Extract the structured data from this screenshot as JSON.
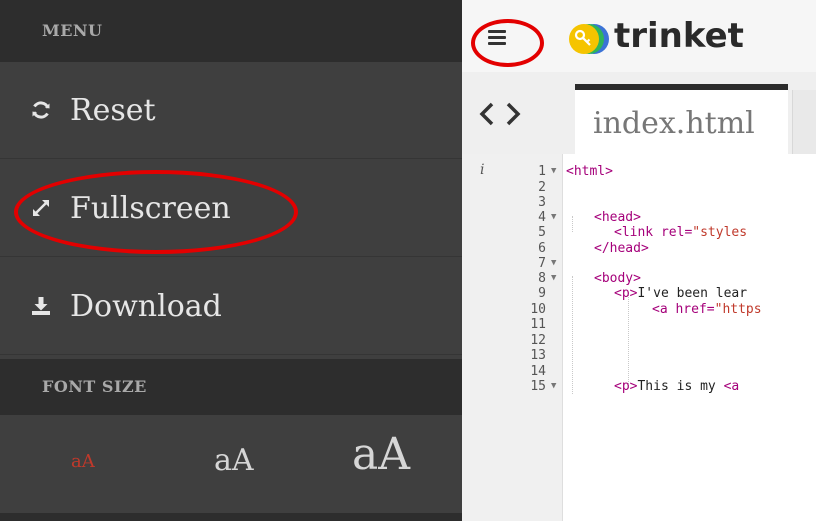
{
  "sidebar": {
    "menu_header": "MENU",
    "items": [
      {
        "label": "Reset",
        "icon": "refresh-icon"
      },
      {
        "label": "Fullscreen",
        "icon": "expand-icon"
      },
      {
        "label": "Download",
        "icon": "download-icon"
      }
    ],
    "font_size_header": "FONT SIZE",
    "font_options": [
      "aA",
      "aA",
      "aA"
    ]
  },
  "header": {
    "brand": "trinket",
    "menu_icon": "hamburger-menu-icon",
    "logo_icon": "trinket-logo-icon"
  },
  "tabs": {
    "nav_arrows": "‹ ›",
    "active_tab": "index.html"
  },
  "editor": {
    "info_marker": "i",
    "line_numbers": [
      "1",
      "2",
      "3",
      "4",
      "5",
      "6",
      "7",
      "8",
      "9",
      "10",
      "11",
      "12",
      "13",
      "14",
      "15"
    ],
    "code": {
      "l1": "<html>",
      "l3": "<head>",
      "l4a": "<link ",
      "l4b": "rel=",
      "l4c": "\"styles",
      "l5": "</head>",
      "l7": "<body>",
      "l8a": "<p>",
      "l8b": "I've been lear",
      "l9a": "<a ",
      "l9b": "href=",
      "l9c": "\"https",
      "l15a": "<p>",
      "l15b": "This is my ",
      "l15c": "<a"
    }
  },
  "colors": {
    "sidebar_bg": "#3f3f3f",
    "sidebar_header_bg": "#2d2d2d",
    "highlight_ring": "#e30000",
    "tag_color": "#a5007a",
    "string_color": "#c0392b"
  }
}
